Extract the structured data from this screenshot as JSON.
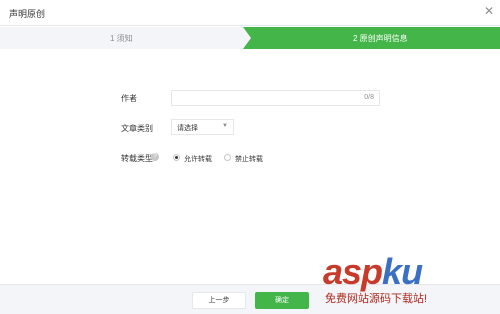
{
  "dialog": {
    "title": "声明原创",
    "close_icon": "close-icon"
  },
  "steps": [
    {
      "label": "1 须知",
      "state": "done"
    },
    {
      "label": "2 原创声明信息",
      "state": "active"
    }
  ],
  "colors": {
    "accent": "#44b549",
    "step_inactive": "#f4f5f9",
    "border": "#e7e7eb",
    "watermark_red": "#c83a2a",
    "watermark_blue": "#3a6fc4"
  },
  "form": {
    "author": {
      "label": "作者",
      "value": "",
      "counter": "0/8"
    },
    "category": {
      "label": "文章类别",
      "selected": "请选择"
    },
    "repost_type": {
      "label": "转载类型",
      "help_icon": "question-icon",
      "options": [
        {
          "label": "允许转载",
          "checked": true
        },
        {
          "label": "禁止转载",
          "checked": false
        }
      ]
    }
  },
  "footer": {
    "prev_label": "上一步",
    "ok_label": "确定"
  },
  "watermark": {
    "brand_part1": "asp",
    "brand_part2": "ku",
    "tagline": "免费网站源码下载站!"
  }
}
